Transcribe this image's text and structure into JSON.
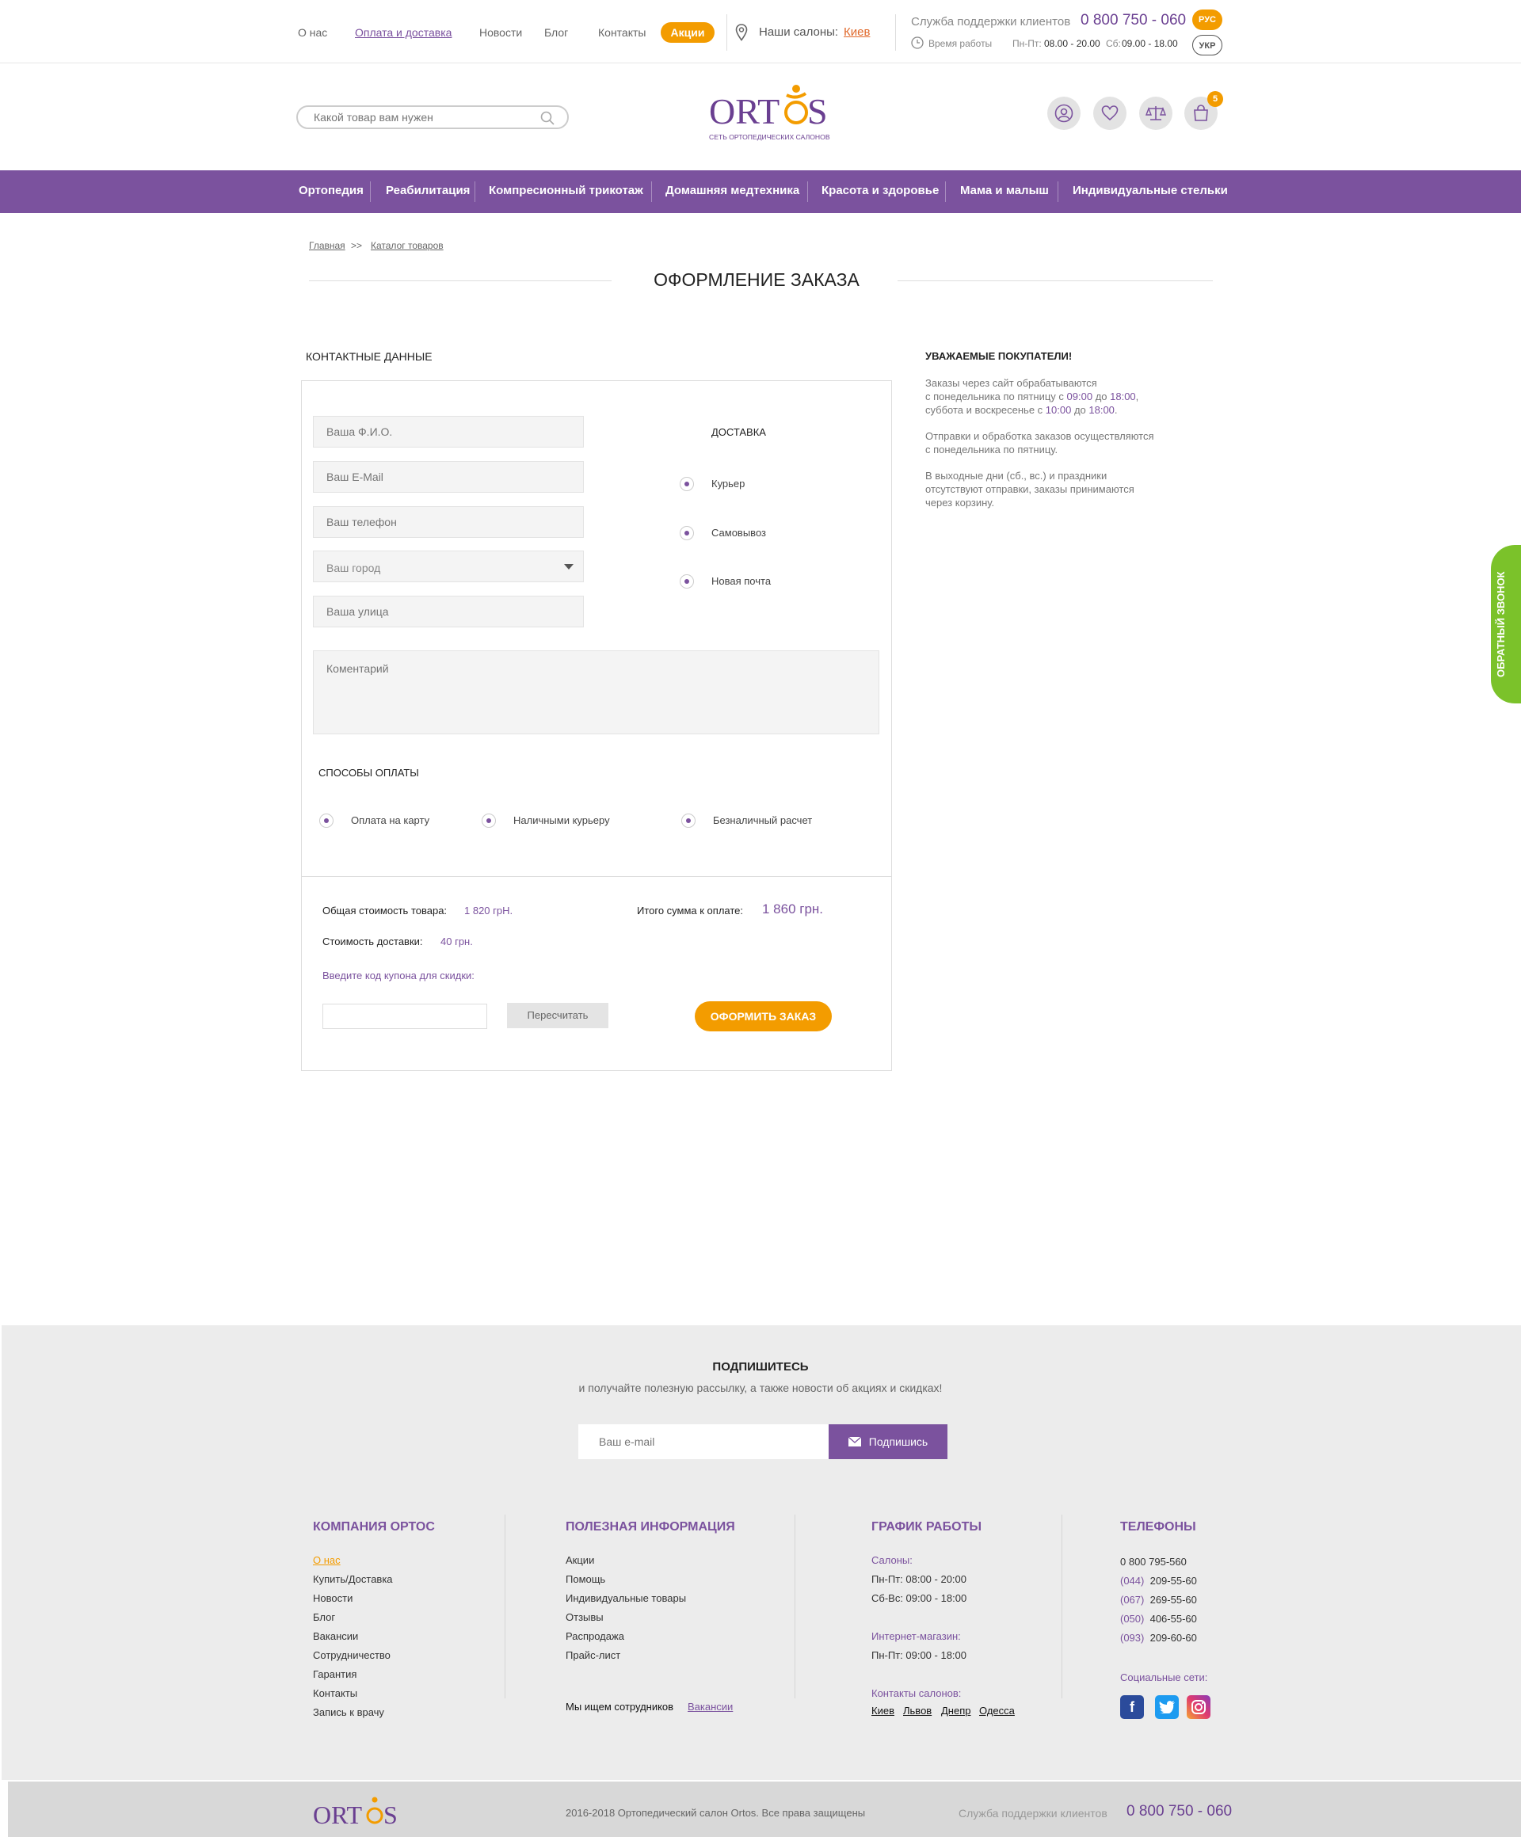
{
  "topbar": {
    "links": [
      "О нас",
      "Оплата и доставка",
      "Новости",
      "Блог",
      "Контакты"
    ],
    "promo": "Акции",
    "salons_label": "Наши салоны:",
    "salons_city": "Киев",
    "support_label": "Служба поддержки клиентов",
    "support_phone": "0 800 750 - 060",
    "hours_label": "Время работы",
    "hours_weekdays_label": "Пн-Пт:",
    "hours_weekdays": "08.00 - 20.00",
    "hours_sat_label": "Сб:",
    "hours_sat": "09.00 - 18.00",
    "lang_active": "РУС",
    "lang_inactive": "УКР"
  },
  "header": {
    "search_placeholder": "Какой товар вам нужен",
    "logo_text": "ORTOS",
    "logo_tagline": "СЕТЬ ОРТОПЕДИЧЕСКИХ САЛОНОВ",
    "cart_count": "5"
  },
  "nav": [
    "Ортопедия",
    "Реабилитация",
    "Компресионный трикотаж",
    "Домашняя медтехника",
    "Красота и здоровье",
    "Мама и малыш",
    "Индивидуальные стельки"
  ],
  "breadcrumb": {
    "home": "Главная",
    "sep": ">>",
    "catalog": "Каталог товаров"
  },
  "page_title": "ОФОРМЛЕНИЕ ЗАКАЗА",
  "contact": {
    "title": "КОНТАКТНЫЕ ДАННЫЕ",
    "name_placeholder": "Ваша Ф.И.О.",
    "email_placeholder": "Ваш E-Mail",
    "phone_placeholder": "Ваш телефон",
    "city_placeholder": "Ваш город",
    "street_placeholder": "Ваша улица",
    "comment_placeholder": "Коментарий"
  },
  "delivery": {
    "title": "ДОСТАВКА",
    "options": [
      "Курьер",
      "Самовывоз",
      "Новая почта"
    ]
  },
  "payment": {
    "title": "СПОСОБЫ ОПЛАТЫ",
    "options": [
      "Оплата на карту",
      "Наличными курьеру",
      "Безналичный расчет"
    ]
  },
  "summary": {
    "goods_label": "Общая стоимость товара:",
    "goods_value": "1 820 грН.",
    "delivery_label": "Стоимость доставки:",
    "delivery_value": "40 грн.",
    "total_label": "Итого сумма к оплате:",
    "total_value": "1 860 грн.",
    "coupon_label": "Введите код купона для скидки:",
    "recalc": "Пересчитать",
    "order": "ОФОРМИТЬ ЗАКАЗ"
  },
  "info": {
    "title": "УВАЖАЕМЫЕ ПОКУПАТЕЛИ!",
    "p1_a": "Заказы через сайт обрабатываются",
    "p1_b": "с понедельника по пятницу с ",
    "p1_t1": "09:00",
    "p1_c": " до ",
    "p1_t2": "18:00",
    "p1_d": ",",
    "p1_e": "суббота и воскресенье с ",
    "p1_t3": "10:00",
    "p1_f": " до ",
    "p1_t4": "18:00",
    "p1_g": ".",
    "p2_a": "Отправки и обработка заказов осуществляются",
    "p2_b": "с понедельника по пятницу.",
    "p3_a": "В выходные дни (сб., вс.) и праздники",
    "p3_b": "отсутствуют отправки, заказы принимаются",
    "p3_c": "через корзину."
  },
  "callback": "ОБРАТНЫЙ ЗВОНОК",
  "subscribe": {
    "title": "ПОДПИШИТЕСЬ",
    "text": "и получайте полезную рассылку, а также новости об акциях и скидках!",
    "placeholder": "Ваш e-mail",
    "button": "Подпишись"
  },
  "footer": {
    "company_title": "КОМПАНИЯ ОРТОС",
    "company_links": [
      "О нас",
      "Купить/Доставка",
      "Новости",
      "Блог",
      "Вакансии",
      "Сотрудничество",
      "Гарантия",
      "Контакты",
      "Запись к врачу"
    ],
    "info_title": "ПОЛЕЗНАЯ ИНФОРМАЦИЯ",
    "info_links": [
      "Акции",
      "Помощь",
      "Индивидуальные товары",
      "Отзывы",
      "Распродажа",
      "Прайс-лист"
    ],
    "jobs_text": "Мы ищем сотрудников",
    "jobs_link": "Вакансии",
    "schedule_title": "ГРАФИК РАБОТЫ",
    "salons_label": "Салоны:",
    "salons_weekdays": "Пн-Пт: 08:00 - 20:00",
    "salons_weekend": "Сб-Вс: 09:00 - 18:00",
    "shop_label": "Интернет-магазин:",
    "shop_weekdays": "Пн-Пт: 09:00 - 18:00",
    "contacts_label": "Контакты салонов:",
    "cities": [
      "Киев",
      "Львов",
      "Днепр",
      "Одесса"
    ],
    "phones_title": "ТЕЛЕФОНЫ",
    "phone_free": "0 800 795-560",
    "phones": [
      {
        "code": "(044)",
        "num": "209-55-60"
      },
      {
        "code": "(067)",
        "num": "269-55-60"
      },
      {
        "code": "(050)",
        "num": "406-55-60"
      },
      {
        "code": "(093)",
        "num": "209-60-60"
      }
    ],
    "social_label": "Социальные сети:",
    "copyright": "2016-2018  Ортопедический салон Ortos. Все права защищены",
    "support_label": "Служба поддержки клиентов",
    "support_phone": "0 800 750 - 060"
  },
  "colors": {
    "brand": "#7b529e",
    "accent": "#f39c00",
    "callback": "#7bc22a"
  }
}
